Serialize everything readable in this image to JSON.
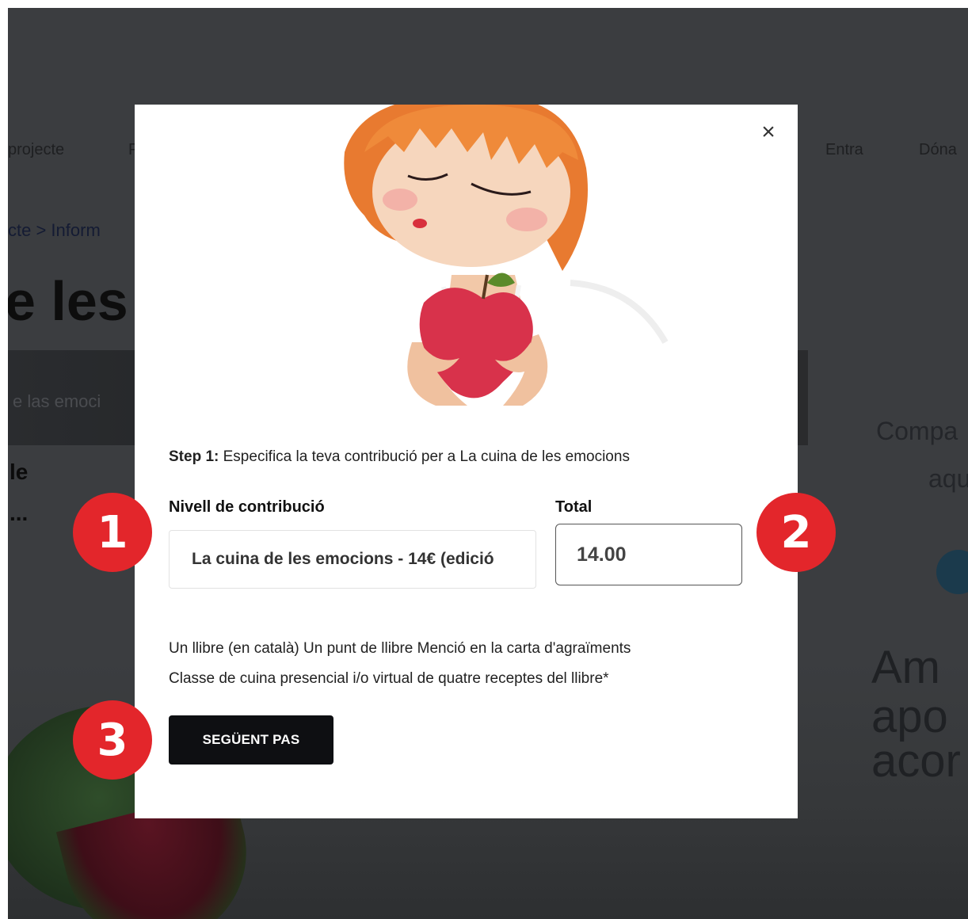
{
  "background": {
    "nav": {
      "projecte": "projecte",
      "partial_p": "P",
      "entra": "Entra",
      "dona": "Dóna"
    },
    "breadcrumb": "cte > Inform",
    "title_fragment": "e les e",
    "hero_text": "e las emoci",
    "side_a": "le",
    "side_b": "...",
    "share_a": "Compa",
    "share_b": "aqu",
    "big_lines": [
      "Am",
      "apo",
      "acor"
    ]
  },
  "modal": {
    "close_symbol": "×",
    "step_prefix": "Step 1:",
    "step_text": " Especifica la teva contribució per a ",
    "step_project": "La cuina de les emocions",
    "level_label": "Nivell de contribució",
    "level_value": "La cuina de les emocions - 14€ (edició",
    "total_label": "Total",
    "total_value": "14.00",
    "desc_line1": "Un llibre (en català) Un punt de llibre Menció en la carta d'agraïments",
    "desc_line2": "Classe de cuina presencial i/o virtual de quatre receptes del llibre*",
    "next_button": "SEGÜENT PAS"
  },
  "badges": [
    "1",
    "2",
    "3"
  ],
  "colors": {
    "badge": "#e3262b",
    "button": "#0e0f12",
    "overlay": "#3b3d40"
  }
}
